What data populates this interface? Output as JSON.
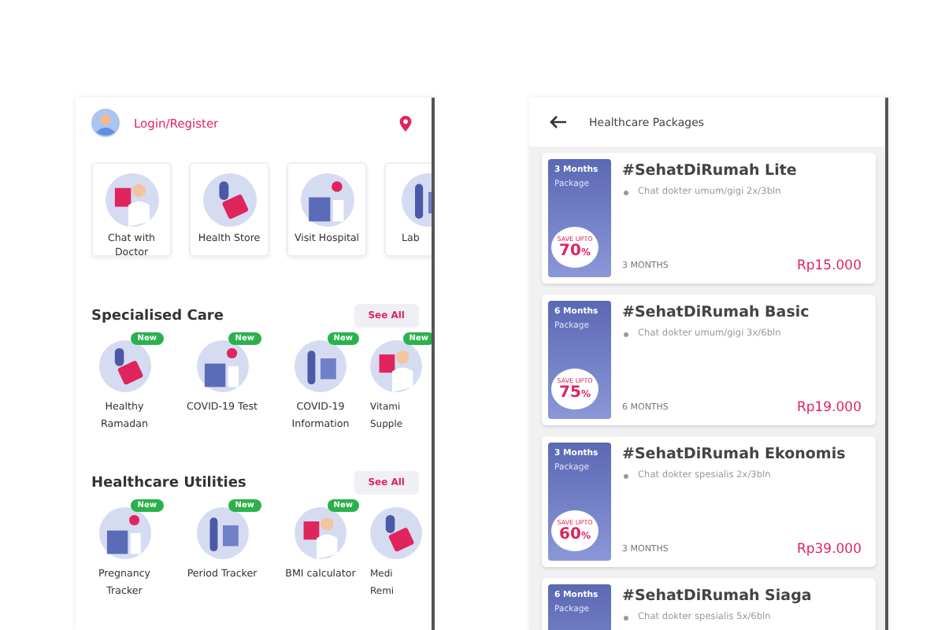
{
  "home": {
    "login_label": "Login/Register",
    "tiles": [
      {
        "label": "Chat with Doctor"
      },
      {
        "label": "Health Store"
      },
      {
        "label": "Visit Hospital"
      },
      {
        "label": "Lab"
      }
    ],
    "sections": [
      {
        "title": "Specialised Care",
        "see_all": "See All",
        "items": [
          {
            "label": "Healthy Ramadan",
            "new": true,
            "badge": "New"
          },
          {
            "label": "COVID-19 Test",
            "new": true,
            "badge": "New"
          },
          {
            "label": "COVID-19 Information",
            "new": true,
            "badge": "New"
          },
          {
            "label": "Vitami Supple",
            "new": true,
            "badge": "New"
          }
        ]
      },
      {
        "title": "Healthcare Utilities",
        "see_all": "See All",
        "items": [
          {
            "label": "Pregnancy Tracker",
            "new": true,
            "badge": "New"
          },
          {
            "label": "Period Tracker",
            "new": true,
            "badge": "New"
          },
          {
            "label": "BMI calculator",
            "new": true,
            "badge": "New"
          },
          {
            "label": "Medi Remi",
            "new": false
          }
        ]
      }
    ]
  },
  "packages_screen": {
    "title": "Healthcare Packages",
    "packages": [
      {
        "duration": "3 Months",
        "package_word": "Package",
        "save_label": "SAVE UPTO",
        "discount": "70",
        "unit": "%",
        "name": "#SehatDiRumah Lite",
        "feature": "Chat dokter umum/gigi 2x/3bln",
        "period": "3 MONTHS",
        "price": "Rp15.000"
      },
      {
        "duration": "6 Months",
        "package_word": "Package",
        "save_label": "SAVE UPTO",
        "discount": "75",
        "unit": "%",
        "name": "#SehatDiRumah Basic",
        "feature": "Chat dokter umum/gigi 3x/6bln",
        "period": "6 MONTHS",
        "price": "Rp19.000"
      },
      {
        "duration": "3 Months",
        "package_word": "Package",
        "save_label": "SAVE UPTO",
        "discount": "60",
        "unit": "%",
        "name": "#SehatDiRumah Ekonomis",
        "feature": "Chat dokter spesialis 2x/3bln",
        "period": "3 MONTHS",
        "price": "Rp39.000"
      },
      {
        "duration": "6 Months",
        "package_word": "Package",
        "name": "#SehatDiRumah Siaga",
        "feature": "Chat dokter spesialis 5x/6bln"
      }
    ]
  }
}
